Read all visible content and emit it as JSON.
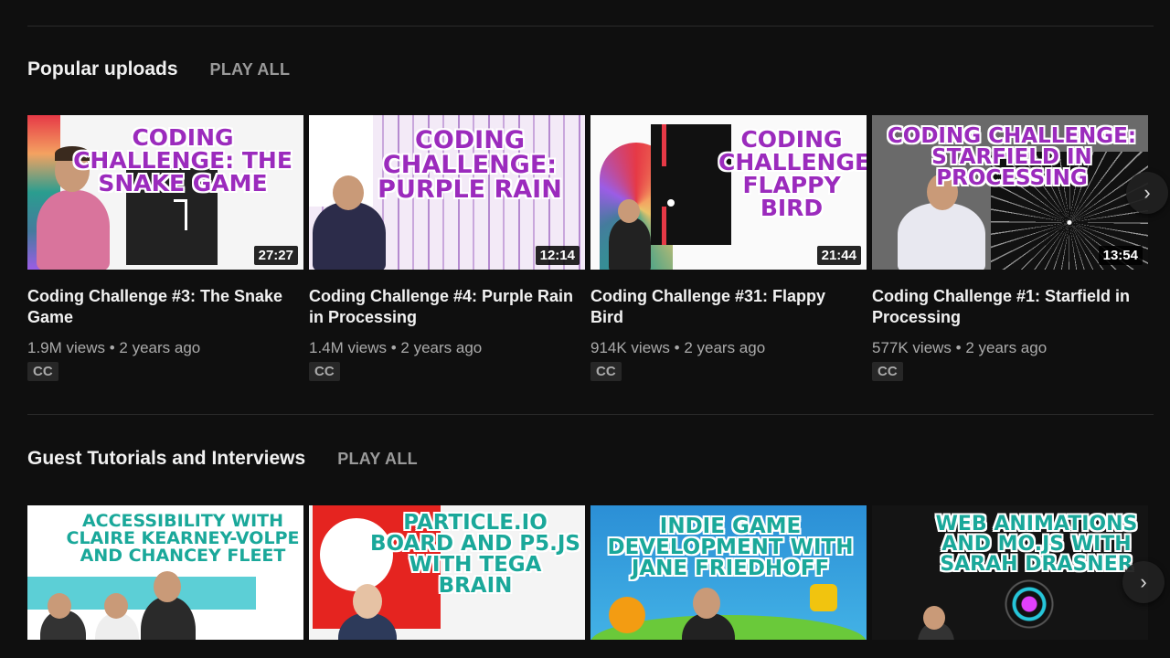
{
  "shelves": [
    {
      "title": "Popular uploads",
      "play_all": "PLAY ALL",
      "videos": [
        {
          "thumb_text": "CODING CHALLENGE: THE SNAKE GAME",
          "duration": "27:27",
          "title": "Coding Challenge #3: The Snake Game",
          "meta": "1.9M views • 2 years ago",
          "badge": "CC"
        },
        {
          "thumb_text": "CODING CHALLENGE: PURPLE RAIN",
          "duration": "12:14",
          "title": "Coding Challenge #4: Purple Rain in Processing",
          "meta": "1.4M views • 2 years ago",
          "badge": "CC"
        },
        {
          "thumb_text": "CODING CHALLENGE: FLAPPY BIRD",
          "duration": "21:44",
          "title": "Coding Challenge #31: Flappy Bird",
          "meta": "914K views • 2 years ago",
          "badge": "CC"
        },
        {
          "thumb_text": "CODING CHALLENGE: STARFIELD IN PROCESSING",
          "duration": "13:54",
          "title": "Coding Challenge #1: Starfield in Processing",
          "meta": "577K views • 2 years ago",
          "badge": "CC"
        }
      ]
    },
    {
      "title": "Guest Tutorials and Interviews",
      "play_all": "PLAY ALL",
      "videos": [
        {
          "thumb_text": "ACCESSIBILITY WITH CLAIRE KEARNEY-VOLPE AND CHANCEY FLEET"
        },
        {
          "thumb_text": "PARTICLE.IO BOARD AND P5.JS WITH TEGA BRAIN"
        },
        {
          "thumb_text": "INDIE GAME DEVELOPMENT WITH JANE FRIEDHOFF"
        },
        {
          "thumb_text": "WEB ANIMATIONS AND MO.JS WITH SARAH DRASNER"
        }
      ]
    }
  ],
  "icons": {
    "next_arrow": "›"
  }
}
